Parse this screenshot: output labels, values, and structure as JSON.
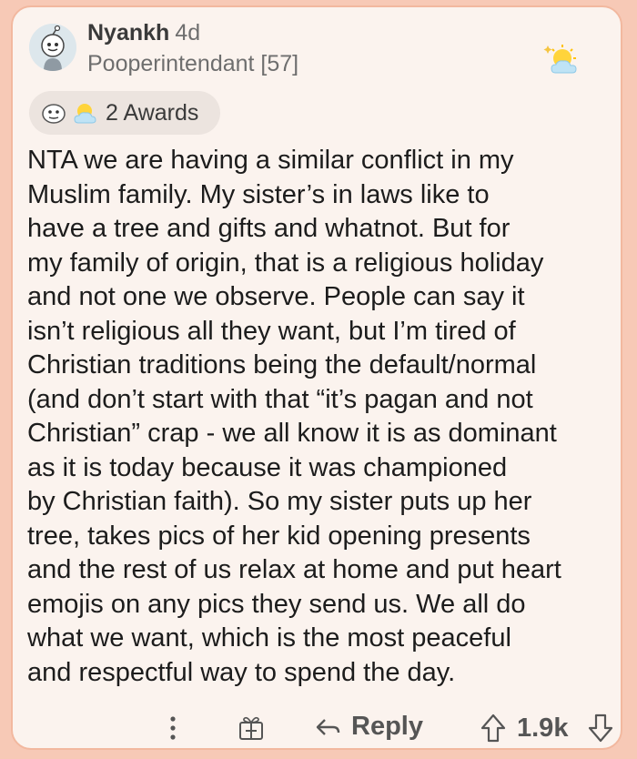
{
  "comment": {
    "author": "Nyankh",
    "age": "4d",
    "flair": "Pooperintendant [57]",
    "awards_label": "2 Awards",
    "body": "NTA we are having a similar conflict in my\nMuslim family. My sister’s in laws like to\nhave a tree and gifts and whatnot. But for\nmy family of origin, that is a religious holiday\nand not one we observe. People can say it\nisn’t religious all they want, but I’m tired of\nChristian traditions being the default/normal\n(and don’t start with that “it’s pagan and not\nChristian” crap - we all know it is as dominant\nas it is today because it was championed\nby Christian faith).  So my sister puts up her\ntree, takes pics of her kid opening presents\nand the rest of us relax at home and put heart\nemojis on any pics they send us. We all do\nwhat we want, which is the most peaceful\nand respectful way to spend the day."
  },
  "actions": {
    "reply_label": "Reply",
    "score": "1.9k"
  },
  "icons": {
    "avatar": "snoo-avatar-icon",
    "top_award": "sun-cloud-award-icon",
    "awards": [
      "face-award-icon",
      "sun-cloud-award-icon"
    ],
    "more": "more-vertical-icon",
    "gift": "gift-award-icon",
    "reply": "reply-arrow-icon",
    "upvote": "upvote-arrow-icon",
    "downvote": "downvote-arrow-icon"
  },
  "colors": {
    "card_background": "#fbf3ee",
    "card_border": "#f2b89f",
    "page_background": "#f7c9b6",
    "meta_text": "#6e6e6e",
    "action_text": "#555555"
  }
}
